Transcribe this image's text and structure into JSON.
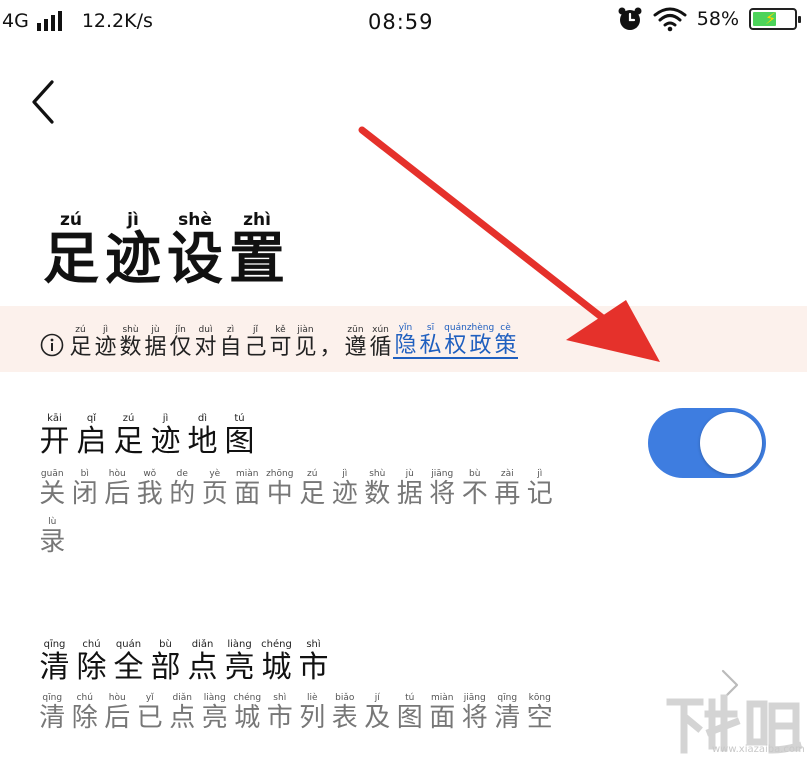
{
  "status_bar": {
    "network": "4G",
    "speed": "12.2K/s",
    "time": "08:59",
    "battery_percent": "58%",
    "battery_level": 0.58,
    "icons": [
      "signal-icon",
      "alarm-icon",
      "wifi-icon",
      "battery-icon"
    ]
  },
  "header": {
    "back_icon": "chevron-left-icon",
    "title": [
      {
        "pinyin": "zú",
        "hanzi": "足"
      },
      {
        "pinyin": "jì",
        "hanzi": "迹"
      },
      {
        "pinyin": "shè",
        "hanzi": "设"
      },
      {
        "pinyin": "zhì",
        "hanzi": "置"
      }
    ]
  },
  "notice": {
    "icon": "info-icon",
    "text": [
      {
        "pinyin": "zú",
        "hanzi": "足"
      },
      {
        "pinyin": "jì",
        "hanzi": "迹"
      },
      {
        "pinyin": "shù",
        "hanzi": "数"
      },
      {
        "pinyin": "jù",
        "hanzi": "据"
      },
      {
        "pinyin": "jǐn",
        "hanzi": "仅"
      },
      {
        "pinyin": "duì",
        "hanzi": "对"
      },
      {
        "pinyin": "zì",
        "hanzi": "自"
      },
      {
        "pinyin": "jǐ",
        "hanzi": "己"
      },
      {
        "pinyin": "kě",
        "hanzi": "可"
      },
      {
        "pinyin": "jiàn",
        "hanzi": "见"
      },
      {
        "pinyin": "",
        "hanzi": "，"
      },
      {
        "pinyin": "zūn",
        "hanzi": "遵"
      },
      {
        "pinyin": "xún",
        "hanzi": "循"
      }
    ],
    "link": [
      {
        "pinyin": "yǐn",
        "hanzi": "隐"
      },
      {
        "pinyin": "sī",
        "hanzi": "私"
      },
      {
        "pinyin": "quán",
        "hanzi": "权"
      },
      {
        "pinyin": "zhèng",
        "hanzi": "政"
      },
      {
        "pinyin": "cè",
        "hanzi": "策"
      }
    ]
  },
  "settings": [
    {
      "title": [
        {
          "pinyin": "kāi",
          "hanzi": "开"
        },
        {
          "pinyin": "qǐ",
          "hanzi": "启"
        },
        {
          "pinyin": "zú",
          "hanzi": "足"
        },
        {
          "pinyin": "jì",
          "hanzi": "迹"
        },
        {
          "pinyin": "dì",
          "hanzi": "地"
        },
        {
          "pinyin": "tú",
          "hanzi": "图"
        }
      ],
      "desc_line1": [
        {
          "pinyin": "guān",
          "hanzi": "关"
        },
        {
          "pinyin": "bì",
          "hanzi": "闭"
        },
        {
          "pinyin": "hòu",
          "hanzi": "后"
        },
        {
          "pinyin": "wǒ",
          "hanzi": "我"
        },
        {
          "pinyin": "de",
          "hanzi": "的"
        },
        {
          "pinyin": "yè",
          "hanzi": "页"
        },
        {
          "pinyin": "miàn",
          "hanzi": "面"
        },
        {
          "pinyin": "zhōng",
          "hanzi": "中"
        },
        {
          "pinyin": "zú",
          "hanzi": "足"
        },
        {
          "pinyin": "jì",
          "hanzi": "迹"
        },
        {
          "pinyin": "shù",
          "hanzi": "数"
        },
        {
          "pinyin": "jù",
          "hanzi": "据"
        },
        {
          "pinyin": "jiāng",
          "hanzi": "将"
        },
        {
          "pinyin": "bù",
          "hanzi": "不"
        },
        {
          "pinyin": "zài",
          "hanzi": "再"
        },
        {
          "pinyin": "jì",
          "hanzi": "记"
        }
      ],
      "desc_line2": [
        {
          "pinyin": "lù",
          "hanzi": "录"
        }
      ],
      "toggle_on": true
    },
    {
      "title": [
        {
          "pinyin": "qīng",
          "hanzi": "清"
        },
        {
          "pinyin": "chú",
          "hanzi": "除"
        },
        {
          "pinyin": "quán",
          "hanzi": "全"
        },
        {
          "pinyin": "bù",
          "hanzi": "部"
        },
        {
          "pinyin": "diǎn",
          "hanzi": "点"
        },
        {
          "pinyin": "liàng",
          "hanzi": "亮"
        },
        {
          "pinyin": "chéng",
          "hanzi": "城"
        },
        {
          "pinyin": "shì",
          "hanzi": "市"
        }
      ],
      "desc_line1": [
        {
          "pinyin": "qīng",
          "hanzi": "清"
        },
        {
          "pinyin": "chú",
          "hanzi": "除"
        },
        {
          "pinyin": "hòu",
          "hanzi": "后"
        },
        {
          "pinyin": "yǐ",
          "hanzi": "已"
        },
        {
          "pinyin": "diǎn",
          "hanzi": "点"
        },
        {
          "pinyin": "liàng",
          "hanzi": "亮"
        },
        {
          "pinyin": "chéng",
          "hanzi": "城"
        },
        {
          "pinyin": "shì",
          "hanzi": "市"
        },
        {
          "pinyin": "liè",
          "hanzi": "列"
        },
        {
          "pinyin": "biǎo",
          "hanzi": "表"
        },
        {
          "pinyin": "jí",
          "hanzi": "及"
        },
        {
          "pinyin": "tú",
          "hanzi": "图"
        },
        {
          "pinyin": "miàn",
          "hanzi": "面"
        },
        {
          "pinyin": "jiāng",
          "hanzi": "将"
        },
        {
          "pinyin": "qīng",
          "hanzi": "清"
        },
        {
          "pinyin": "kōng",
          "hanzi": "空"
        }
      ],
      "chevron_icon": "chevron-right-icon"
    }
  ],
  "annotation": {
    "arrow_color": "#e5312b"
  },
  "watermark": {
    "logo_text": "下载吧",
    "url": "www.xiazaiba.com"
  },
  "colors": {
    "accent": "#3e7de0",
    "link": "#1f5fbf",
    "notice_bg": "#fcf1ec"
  }
}
